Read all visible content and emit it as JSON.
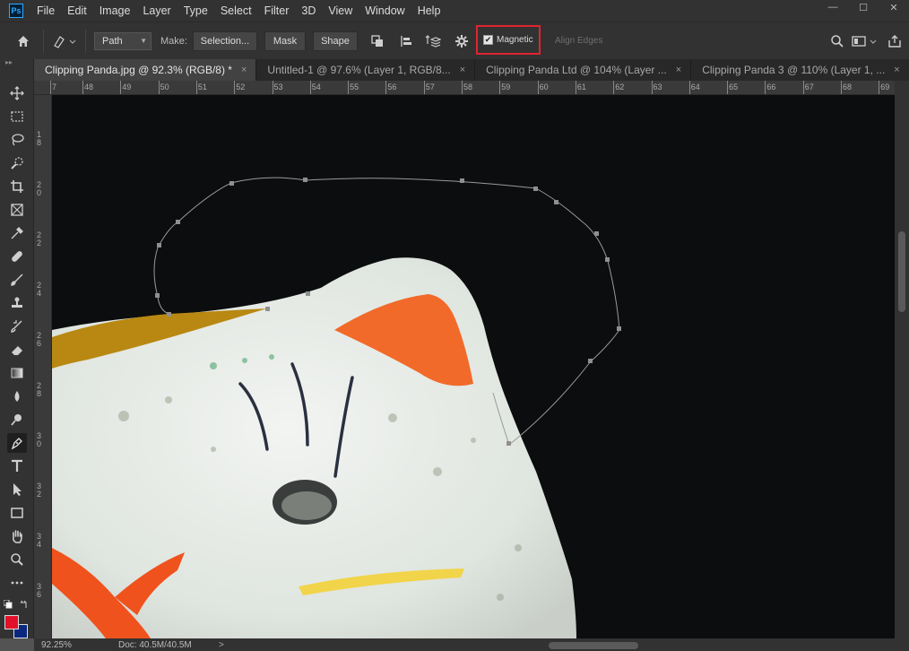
{
  "app": {
    "logo": "Ps"
  },
  "menu": [
    "File",
    "Edit",
    "Image",
    "Layer",
    "Type",
    "Select",
    "Filter",
    "3D",
    "View",
    "Window",
    "Help"
  ],
  "window_controls": {
    "minimize": "—",
    "maximize": "☐",
    "close": "✕"
  },
  "options": {
    "path_mode": "Path",
    "make_label": "Make:",
    "selection_button": "Selection...",
    "mask_button": "Mask",
    "shape_button": "Shape",
    "magnetic_label": "Magnetic",
    "magnetic_checked": true,
    "align_edges": "Align Edges",
    "highlight_color": "#e1242f"
  },
  "tabs": [
    {
      "label": "Clipping Panda.jpg @ 92.3% (RGB/8) *",
      "active": true
    },
    {
      "label": "Untitled-1 @ 97.6% (Layer 1, RGB/8...",
      "active": false
    },
    {
      "label": "Clipping Panda Ltd @ 104% (Layer ...",
      "active": false
    },
    {
      "label": "Clipping Panda 3 @ 110% (Layer 1, ...",
      "active": false
    }
  ],
  "tab_close": "×",
  "ruler_h": [
    "7",
    "48",
    "49",
    "50",
    "51",
    "52",
    "53",
    "54",
    "55",
    "56",
    "57",
    "58",
    "59",
    "60",
    "61",
    "62",
    "63",
    "64",
    "65",
    "66",
    "67",
    "68",
    "69"
  ],
  "ruler_v": [
    "1\n8",
    "2\n0",
    "2\n2",
    "2\n4",
    "2\n6",
    "2\n8",
    "3\n0",
    "3\n2",
    "3\n4",
    "3\n6"
  ],
  "tools": [
    "move-icon",
    "marquee-icon",
    "lasso-icon",
    "quick-select-icon",
    "crop-icon",
    "frame-icon",
    "eyedropper-icon",
    "healing-brush-icon",
    "brush-icon",
    "clone-stamp-icon",
    "history-brush-icon",
    "eraser-icon",
    "gradient-icon",
    "blur-icon",
    "dodge-icon",
    "pen-icon",
    "type-icon",
    "path-selection-icon",
    "rectangle-icon",
    "hand-icon",
    "zoom-icon",
    "more-tools-icon"
  ],
  "colors": {
    "foreground": "#e3102b",
    "background": "#0b2880",
    "canvas": "#0b0d0e"
  },
  "status": {
    "zoom": "92.25%",
    "doc": "Doc: 40.5M/40.5M",
    "arrow": ">"
  }
}
